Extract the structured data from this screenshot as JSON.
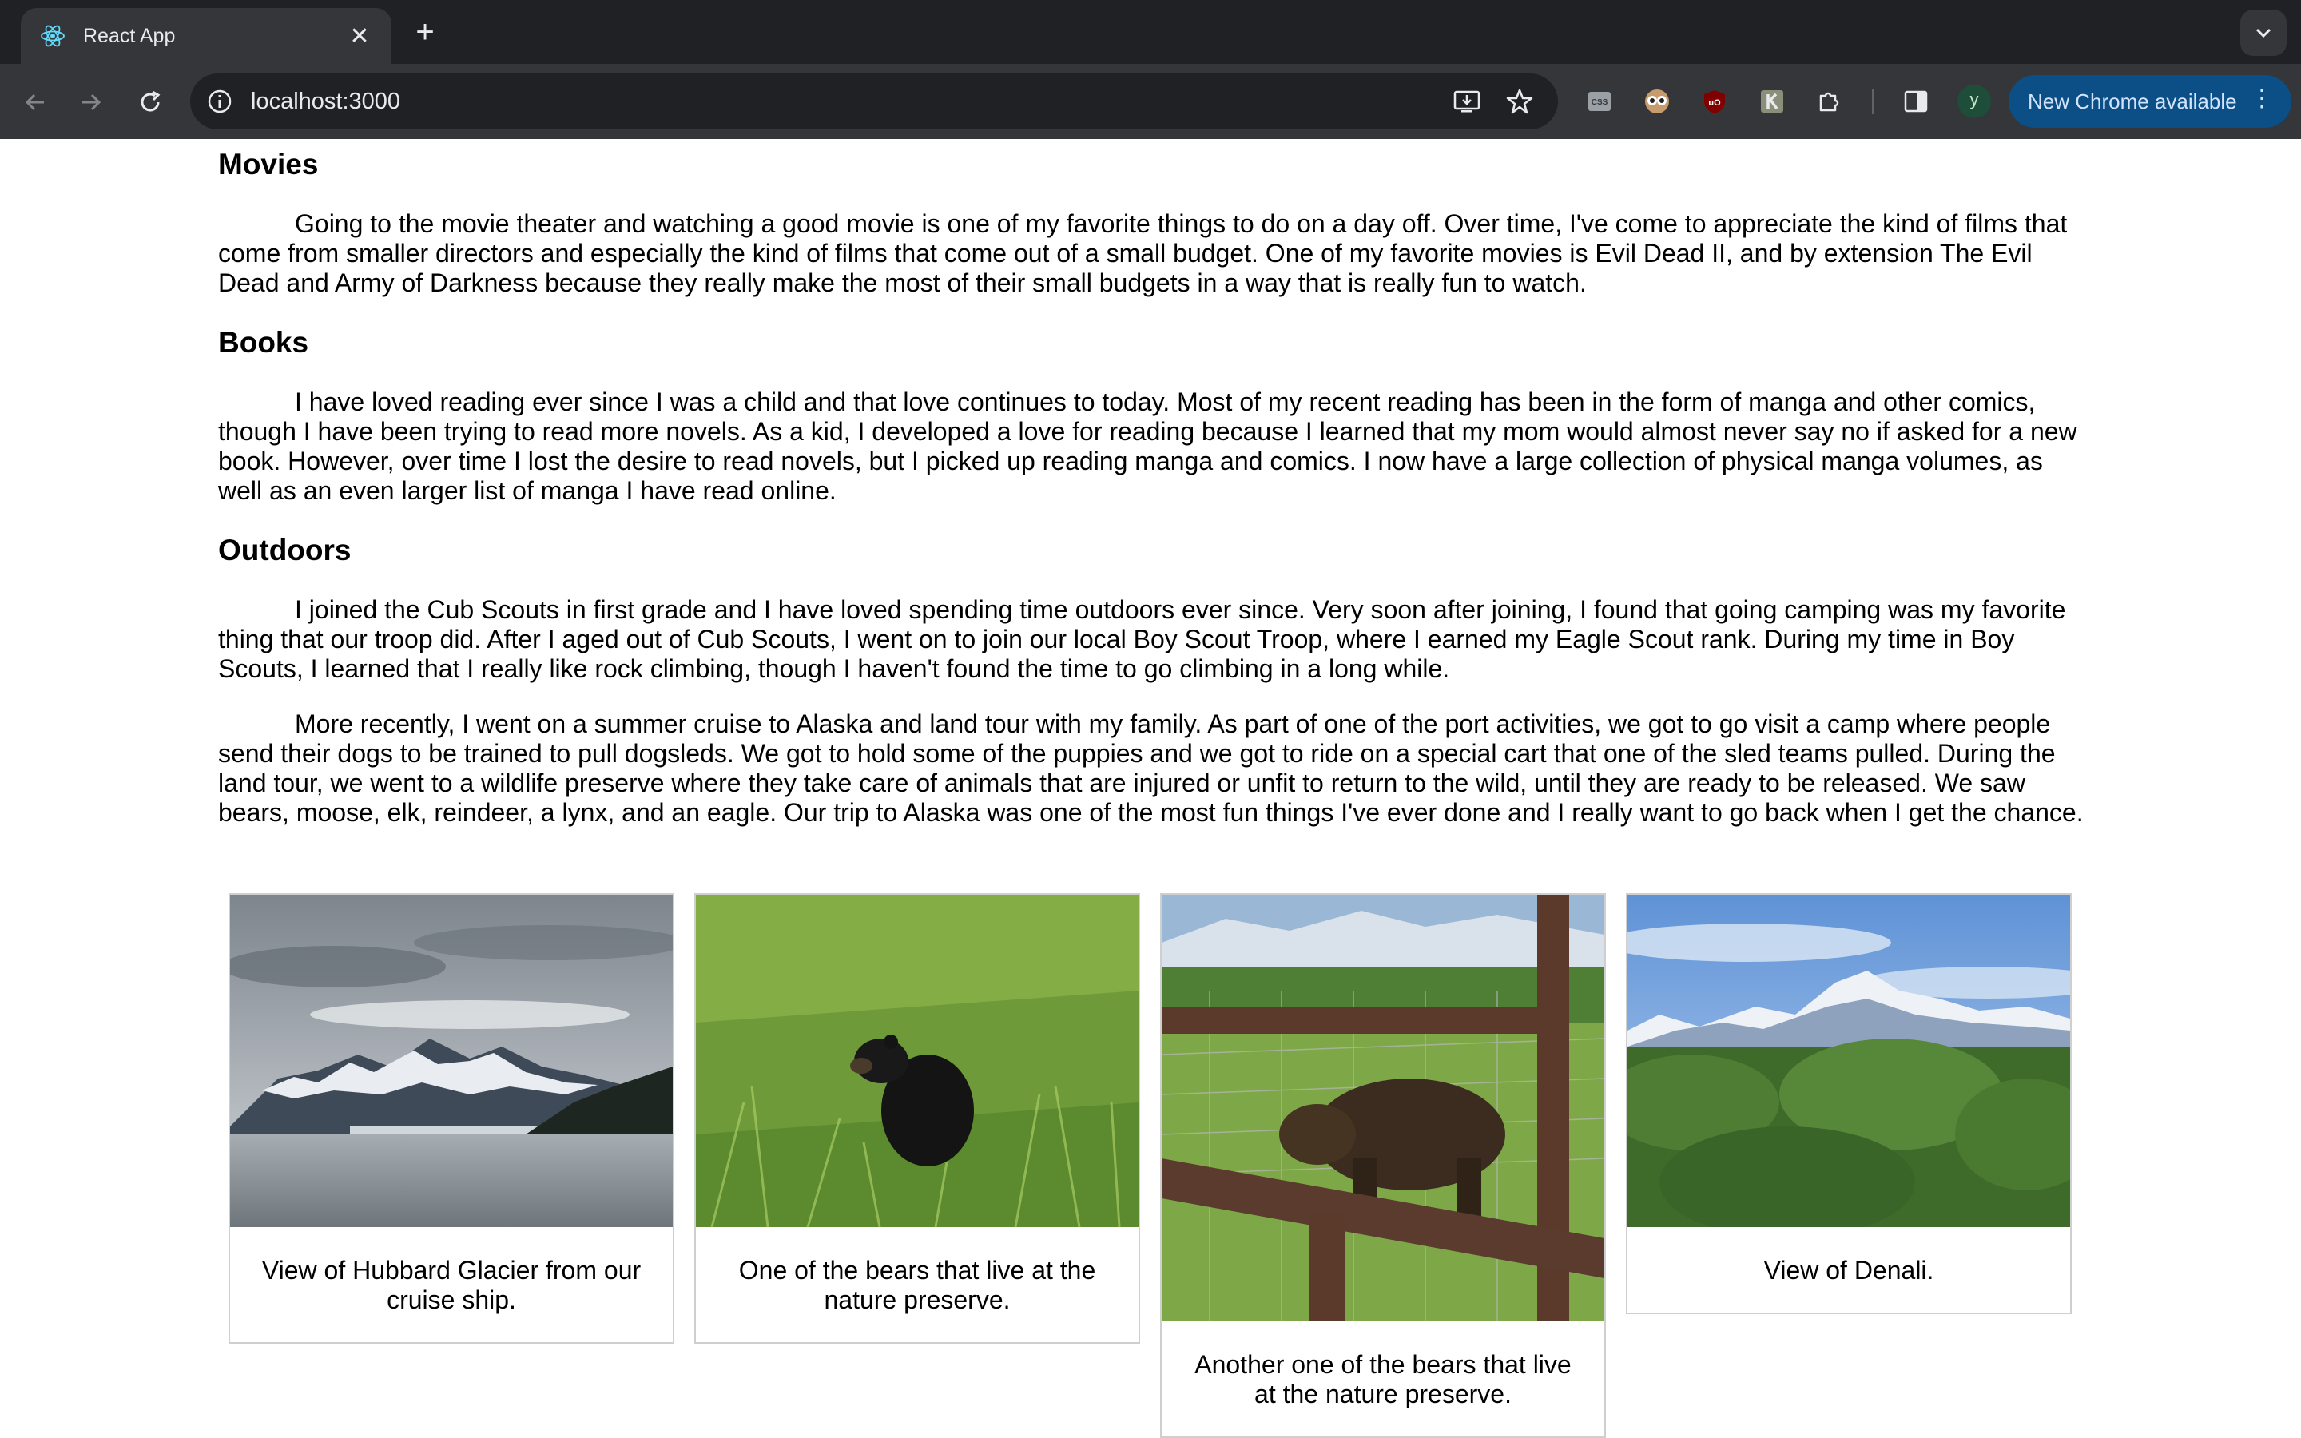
{
  "browser": {
    "tab_title": "React App",
    "url": "localhost:3000",
    "update_button_label": "New Chrome available",
    "profile_initial": "y"
  },
  "sections": [
    {
      "heading": "Movies",
      "paragraphs": [
        "Going to the movie theater and watching a good movie is one of my favorite things to do on a day off. Over time, I've come to appreciate the kind of films that come from smaller directors and especially the kind of films that come out of a small budget. One of my favorite movies is Evil Dead II, and by extension The Evil Dead and Army of Darkness because they really make the most of their small budgets in a way that is really fun to watch."
      ]
    },
    {
      "heading": "Books",
      "paragraphs": [
        "I have loved reading ever since I was a child and that love continues to today. Most of my recent reading has been in the form of manga and other comics, though I have been trying to read more novels. As a kid, I developed a love for reading because I learned that my mom would almost never say no if asked for a new book. However, over time I lost the desire to read novels, but I picked up reading manga and comics. I now have a large collection of physical manga volumes, as well as an even larger list of manga I have read online."
      ]
    },
    {
      "heading": "Outdoors",
      "paragraphs": [
        "I joined the Cub Scouts in first grade and I have loved spending time outdoors ever since. Very soon after joining, I found that going camping was my favorite thing that our troop did. After I aged out of Cub Scouts, I went on to join our local Boy Scout Troop, where I earned my Eagle Scout rank. During my time in Boy Scouts, I learned that I really like rock climbing, though I haven't found the time to go climbing in a long while.",
        "More recently, I went on a summer cruise to Alaska and land tour with my family. As part of one of the port activities, we got to go visit a camp where people send their dogs to be trained to pull dogsleds. We got to hold some of the puppies and we got to ride on a special cart that one of the sled teams pulled. During the land tour, we went to a wildlife preserve where they take care of animals that are injured or unfit to return to the wild, until they are ready to be released. We saw bears, moose, elk, reindeer, a lynx, and an eagle. Our trip to Alaska was one of the most fun things I've ever done and I really want to go back when I get the chance."
      ]
    }
  ],
  "gallery": [
    {
      "caption": "View of Hubbard Glacier from our cruise ship.",
      "photo": "glacier"
    },
    {
      "caption": "One of the bears that live at the nature preserve.",
      "photo": "bear-grass"
    },
    {
      "caption": "Another one of the bears that live at the nature preserve.",
      "photo": "bear-fence"
    },
    {
      "caption": "View of Denali.",
      "photo": "denali"
    }
  ]
}
